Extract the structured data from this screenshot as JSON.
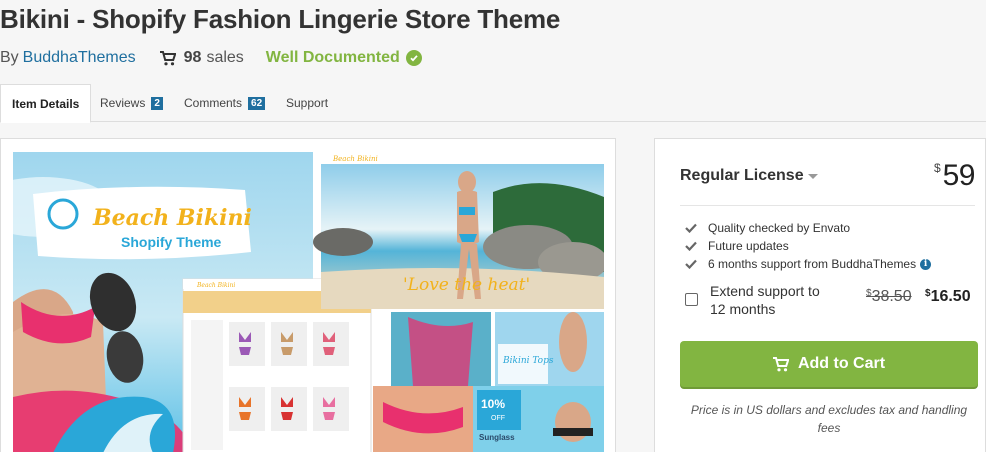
{
  "item": {
    "title": "Bikini - Shopify Fashion Lingerie Store Theme",
    "by_label": "By",
    "author": "BuddhaThemes",
    "sales_count": "98",
    "sales_label": "sales",
    "documented_label": "Well Documented"
  },
  "tabs": [
    {
      "label": "Item Details",
      "active": true
    },
    {
      "label": "Reviews",
      "count": "2"
    },
    {
      "label": "Comments",
      "count": "62"
    },
    {
      "label": "Support"
    }
  ],
  "preview": {
    "brand_line1": "Beach Bikini",
    "brand_line2": "Shopify Theme",
    "hero_slogan": "'Love the heat'",
    "promo_title": "Bikini Tops",
    "discount": "10%",
    "discount_sub": "OFF",
    "promo_bottom": "Sunglass",
    "nav_brand": "Beach Bikini"
  },
  "license": {
    "name": "Regular License",
    "currency": "$",
    "price": "59",
    "features": [
      "Quality checked by Envato",
      "Future updates",
      "6 months support from BuddhaThemes"
    ],
    "extend_label": "Extend support to 12 months",
    "extend_old_price": "38.50",
    "extend_new_price": "16.50",
    "add_to_cart": "Add to Cart",
    "price_note": "Price is in US dollars and excludes tax and handling fees"
  },
  "colors": {
    "accent_green": "#82b541",
    "link_blue": "#1f6f9f",
    "sea_blue": "#2aa7d8"
  }
}
